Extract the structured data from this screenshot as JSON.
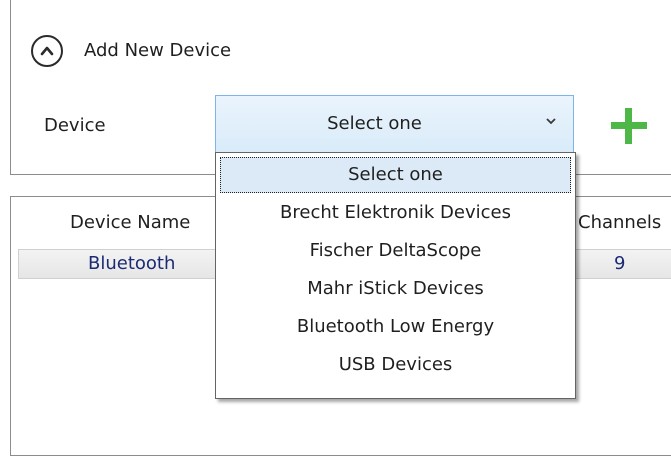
{
  "add_section": {
    "title": "Add New Device",
    "device_label": "Device",
    "selected_value": "Select one",
    "options": [
      "Select one",
      "Brecht Elektronik Devices",
      "Fischer DeltaScope",
      "Mahr iStick Devices",
      "Bluetooth Low Energy",
      "USB Devices"
    ]
  },
  "device_table": {
    "headers": [
      "Device Name",
      "Channels"
    ],
    "rows": [
      [
        "Bluetooth",
        "9"
      ]
    ]
  },
  "colors": {
    "accent_green": "#4db848",
    "combo_border": "#7eb4ea",
    "row_text": "#1b2a73"
  },
  "icons": {
    "expander": "chevron-up-circle-icon",
    "combo_arrow": "chevron-down-icon",
    "add": "plus-icon"
  }
}
